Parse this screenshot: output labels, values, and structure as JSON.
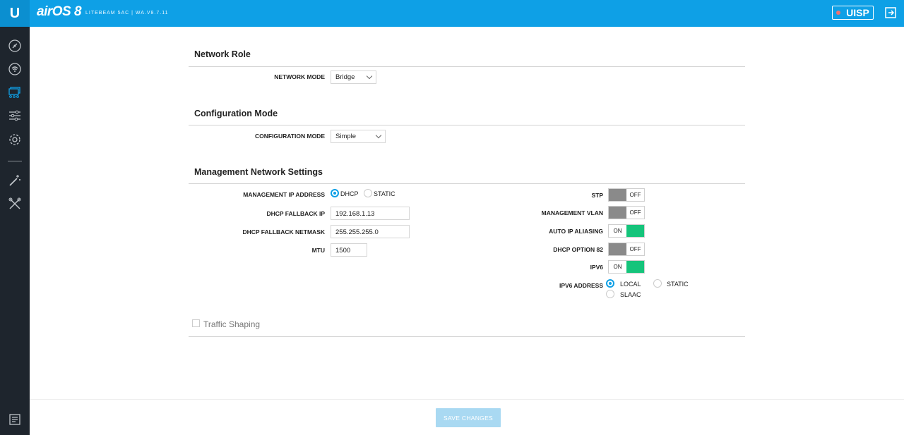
{
  "header": {
    "logo": "U",
    "brand": "airOS 8",
    "device_info": "LITEBEAM 5AC | WA.V8.7.11",
    "uisp_label": "UISP",
    "uisp_status_color": "#f07070",
    "accent": "#0ea0e6"
  },
  "sidebar": {
    "items": [
      {
        "icon": "dashboard-icon"
      },
      {
        "icon": "wireless-icon"
      },
      {
        "icon": "network-icon"
      },
      {
        "icon": "services-icon"
      },
      {
        "icon": "system-icon"
      },
      {
        "icon": "tools-wand-icon"
      },
      {
        "icon": "utilities-icon"
      },
      {
        "icon": "log-icon"
      }
    ]
  },
  "network_role": {
    "title": "Network Role",
    "network_mode_label": "NETWORK MODE",
    "network_mode_value": "Bridge"
  },
  "configuration_mode": {
    "title": "Configuration Mode",
    "label": "CONFIGURATION MODE",
    "value": "Simple"
  },
  "management": {
    "title": "Management Network Settings",
    "ip_address_label": "MANAGEMENT IP ADDRESS",
    "ip_options": [
      "DHCP",
      "STATIC"
    ],
    "ip_selected": "DHCP",
    "fallback_ip_label": "DHCP FALLBACK IP",
    "fallback_ip_value": "192.168.1.13",
    "fallback_netmask_label": "DHCP FALLBACK NETMASK",
    "fallback_netmask_value": "255.255.255.0",
    "mtu_label": "MTU",
    "mtu_value": "1500",
    "stp_label": "STP",
    "stp_state": "OFF",
    "mgmt_vlan_label": "MANAGEMENT VLAN",
    "mgmt_vlan_state": "OFF",
    "auto_ip_label": "AUTO IP ALIASING",
    "auto_ip_state": "ON",
    "dhcp82_label": "DHCP OPTION 82",
    "dhcp82_state": "OFF",
    "ipv6_label": "IPV6",
    "ipv6_state": "ON",
    "ipv6_address_label": "IPV6 ADDRESS",
    "ipv6_options": [
      "LOCAL",
      "STATIC",
      "SLAAC"
    ],
    "ipv6_selected": "LOCAL"
  },
  "traffic_shaping": {
    "label": "Traffic Shaping",
    "checked": false
  },
  "footer": {
    "save_label": "SAVE CHANGES"
  }
}
